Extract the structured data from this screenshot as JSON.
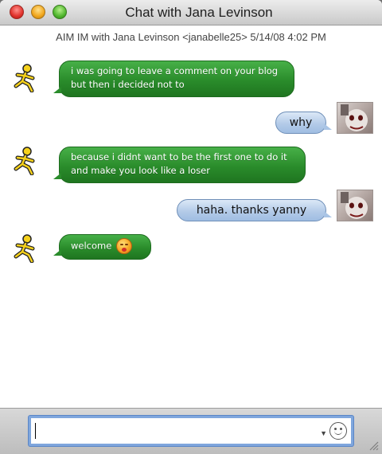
{
  "window": {
    "title": "Chat with Jana Levinson"
  },
  "session_header": "AIM IM with Jana Levinson <janabelle25>  5/14/08 4:02 PM",
  "messages": [
    {
      "from": "buddy",
      "text": "i was going to leave a comment on your blog but then i decided not to"
    },
    {
      "from": "self",
      "text": "why"
    },
    {
      "from": "buddy",
      "text": "because i didnt want to be the first one to do it and make you look like a loser"
    },
    {
      "from": "self",
      "text": "haha. thanks yanny"
    },
    {
      "from": "buddy",
      "text": "welcome",
      "emoticon": "kiss-emoticon-icon"
    }
  ],
  "input": {
    "value": "",
    "emoticon_button": "smiley-icon",
    "font_menu": "dropdown-arrow-icon"
  },
  "icons": {
    "buddy": "aim-running-man-icon",
    "self": "user-avatar-photo"
  },
  "colors": {
    "buddy_bubble": "#2a8c2b",
    "self_bubble": "#b4cbe8",
    "input_focus": "#7fa6dd"
  }
}
